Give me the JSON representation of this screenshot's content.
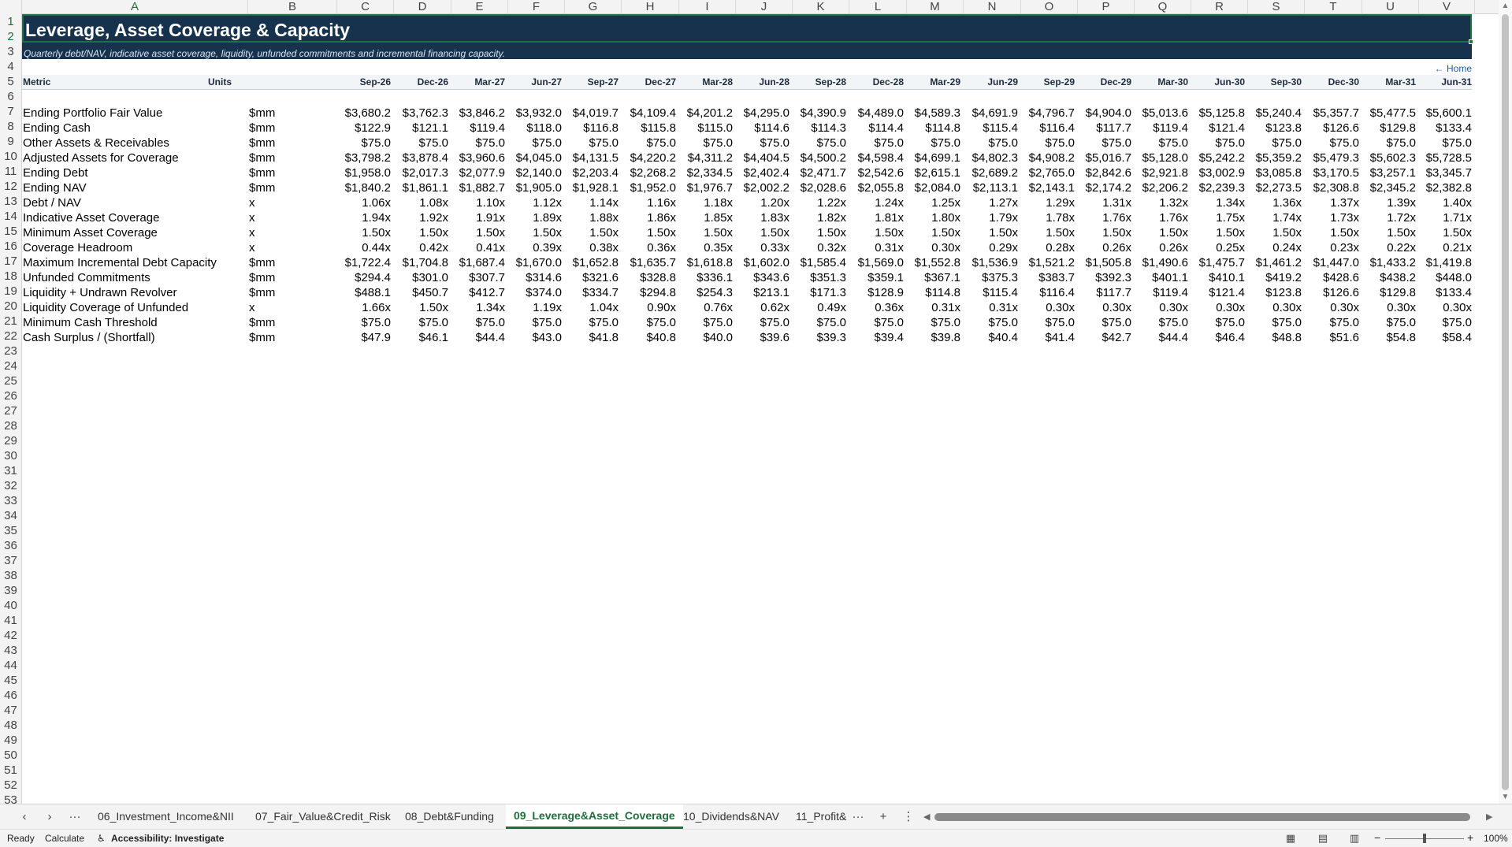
{
  "columns": [
    "A",
    "B",
    "C",
    "D",
    "E",
    "F",
    "G",
    "H",
    "I",
    "J",
    "K",
    "L",
    "M",
    "N",
    "O",
    "P",
    "Q",
    "R",
    "S",
    "T",
    "U",
    "V"
  ],
  "sheet": {
    "title": "Leverage, Asset Coverage & Capacity",
    "subtitle": "Quarterly debt/NAV, indicative asset coverage, liquidity, unfunded commitments and incremental financing capacity.",
    "home_link": "← Home",
    "header": {
      "metric": "Metric",
      "units": "Units"
    },
    "periods": [
      "Sep-26",
      "Dec-26",
      "Mar-27",
      "Jun-27",
      "Sep-27",
      "Dec-27",
      "Mar-28",
      "Jun-28",
      "Sep-28",
      "Dec-28",
      "Mar-29",
      "Jun-29",
      "Sep-29",
      "Dec-29",
      "Mar-30",
      "Jun-30",
      "Sep-30",
      "Dec-30",
      "Mar-31",
      "Jun-31"
    ],
    "rows": [
      {
        "metric": "Ending Portfolio Fair Value",
        "units": "$mm",
        "values": [
          "$3,680.2",
          "$3,762.3",
          "$3,846.2",
          "$3,932.0",
          "$4,019.7",
          "$4,109.4",
          "$4,201.2",
          "$4,295.0",
          "$4,390.9",
          "$4,489.0",
          "$4,589.3",
          "$4,691.9",
          "$4,796.7",
          "$4,904.0",
          "$5,013.6",
          "$5,125.8",
          "$5,240.4",
          "$5,357.7",
          "$5,477.5",
          "$5,600.1"
        ]
      },
      {
        "metric": "Ending Cash",
        "units": "$mm",
        "values": [
          "$122.9",
          "$121.1",
          "$119.4",
          "$118.0",
          "$116.8",
          "$115.8",
          "$115.0",
          "$114.6",
          "$114.3",
          "$114.4",
          "$114.8",
          "$115.4",
          "$116.4",
          "$117.7",
          "$119.4",
          "$121.4",
          "$123.8",
          "$126.6",
          "$129.8",
          "$133.4"
        ]
      },
      {
        "metric": "Other Assets & Receivables",
        "units": "$mm",
        "values": [
          "$75.0",
          "$75.0",
          "$75.0",
          "$75.0",
          "$75.0",
          "$75.0",
          "$75.0",
          "$75.0",
          "$75.0",
          "$75.0",
          "$75.0",
          "$75.0",
          "$75.0",
          "$75.0",
          "$75.0",
          "$75.0",
          "$75.0",
          "$75.0",
          "$75.0",
          "$75.0"
        ]
      },
      {
        "metric": "Adjusted Assets for Coverage",
        "units": "$mm",
        "values": [
          "$3,798.2",
          "$3,878.4",
          "$3,960.6",
          "$4,045.0",
          "$4,131.5",
          "$4,220.2",
          "$4,311.2",
          "$4,404.5",
          "$4,500.2",
          "$4,598.4",
          "$4,699.1",
          "$4,802.3",
          "$4,908.2",
          "$5,016.7",
          "$5,128.0",
          "$5,242.2",
          "$5,359.2",
          "$5,479.3",
          "$5,602.3",
          "$5,728.5"
        ]
      },
      {
        "metric": "Ending Debt",
        "units": "$mm",
        "values": [
          "$1,958.0",
          "$2,017.3",
          "$2,077.9",
          "$2,140.0",
          "$2,203.4",
          "$2,268.2",
          "$2,334.5",
          "$2,402.4",
          "$2,471.7",
          "$2,542.6",
          "$2,615.1",
          "$2,689.2",
          "$2,765.0",
          "$2,842.6",
          "$2,921.8",
          "$3,002.9",
          "$3,085.8",
          "$3,170.5",
          "$3,257.1",
          "$3,345.7"
        ]
      },
      {
        "metric": "Ending NAV",
        "units": "$mm",
        "values": [
          "$1,840.2",
          "$1,861.1",
          "$1,882.7",
          "$1,905.0",
          "$1,928.1",
          "$1,952.0",
          "$1,976.7",
          "$2,002.2",
          "$2,028.6",
          "$2,055.8",
          "$2,084.0",
          "$2,113.1",
          "$2,143.1",
          "$2,174.2",
          "$2,206.2",
          "$2,239.3",
          "$2,273.5",
          "$2,308.8",
          "$2,345.2",
          "$2,382.8"
        ]
      },
      {
        "metric": "Debt / NAV",
        "units": "x",
        "values": [
          "1.06x",
          "1.08x",
          "1.10x",
          "1.12x",
          "1.14x",
          "1.16x",
          "1.18x",
          "1.20x",
          "1.22x",
          "1.24x",
          "1.25x",
          "1.27x",
          "1.29x",
          "1.31x",
          "1.32x",
          "1.34x",
          "1.36x",
          "1.37x",
          "1.39x",
          "1.40x"
        ]
      },
      {
        "metric": "Indicative Asset Coverage",
        "units": "x",
        "values": [
          "1.94x",
          "1.92x",
          "1.91x",
          "1.89x",
          "1.88x",
          "1.86x",
          "1.85x",
          "1.83x",
          "1.82x",
          "1.81x",
          "1.80x",
          "1.79x",
          "1.78x",
          "1.76x",
          "1.76x",
          "1.75x",
          "1.74x",
          "1.73x",
          "1.72x",
          "1.71x"
        ]
      },
      {
        "metric": "Minimum Asset Coverage",
        "units": "x",
        "values": [
          "1.50x",
          "1.50x",
          "1.50x",
          "1.50x",
          "1.50x",
          "1.50x",
          "1.50x",
          "1.50x",
          "1.50x",
          "1.50x",
          "1.50x",
          "1.50x",
          "1.50x",
          "1.50x",
          "1.50x",
          "1.50x",
          "1.50x",
          "1.50x",
          "1.50x",
          "1.50x"
        ]
      },
      {
        "metric": "Coverage Headroom",
        "units": "x",
        "values": [
          "0.44x",
          "0.42x",
          "0.41x",
          "0.39x",
          "0.38x",
          "0.36x",
          "0.35x",
          "0.33x",
          "0.32x",
          "0.31x",
          "0.30x",
          "0.29x",
          "0.28x",
          "0.26x",
          "0.26x",
          "0.25x",
          "0.24x",
          "0.23x",
          "0.22x",
          "0.21x"
        ]
      },
      {
        "metric": "Maximum Incremental Debt Capacity",
        "units": "$mm",
        "values": [
          "$1,722.4",
          "$1,704.8",
          "$1,687.4",
          "$1,670.0",
          "$1,652.8",
          "$1,635.7",
          "$1,618.8",
          "$1,602.0",
          "$1,585.4",
          "$1,569.0",
          "$1,552.8",
          "$1,536.9",
          "$1,521.2",
          "$1,505.8",
          "$1,490.6",
          "$1,475.7",
          "$1,461.2",
          "$1,447.0",
          "$1,433.2",
          "$1,419.8"
        ]
      },
      {
        "metric": "Unfunded Commitments",
        "units": "$mm",
        "values": [
          "$294.4",
          "$301.0",
          "$307.7",
          "$314.6",
          "$321.6",
          "$328.8",
          "$336.1",
          "$343.6",
          "$351.3",
          "$359.1",
          "$367.1",
          "$375.3",
          "$383.7",
          "$392.3",
          "$401.1",
          "$410.1",
          "$419.2",
          "$428.6",
          "$438.2",
          "$448.0"
        ]
      },
      {
        "metric": "Liquidity + Undrawn Revolver",
        "units": "$mm",
        "values": [
          "$488.1",
          "$450.7",
          "$412.7",
          "$374.0",
          "$334.7",
          "$294.8",
          "$254.3",
          "$213.1",
          "$171.3",
          "$128.9",
          "$114.8",
          "$115.4",
          "$116.4",
          "$117.7",
          "$119.4",
          "$121.4",
          "$123.8",
          "$126.6",
          "$129.8",
          "$133.4"
        ]
      },
      {
        "metric": "Liquidity Coverage of Unfunded",
        "units": "x",
        "values": [
          "1.66x",
          "1.50x",
          "1.34x",
          "1.19x",
          "1.04x",
          "0.90x",
          "0.76x",
          "0.62x",
          "0.49x",
          "0.36x",
          "0.31x",
          "0.31x",
          "0.30x",
          "0.30x",
          "0.30x",
          "0.30x",
          "0.30x",
          "0.30x",
          "0.30x",
          "0.30x"
        ]
      },
      {
        "metric": "Minimum Cash Threshold",
        "units": "$mm",
        "values": [
          "$75.0",
          "$75.0",
          "$75.0",
          "$75.0",
          "$75.0",
          "$75.0",
          "$75.0",
          "$75.0",
          "$75.0",
          "$75.0",
          "$75.0",
          "$75.0",
          "$75.0",
          "$75.0",
          "$75.0",
          "$75.0",
          "$75.0",
          "$75.0",
          "$75.0",
          "$75.0"
        ]
      },
      {
        "metric": "Cash Surplus / (Shortfall)",
        "units": "$mm",
        "values": [
          "$47.9",
          "$46.1",
          "$44.4",
          "$43.0",
          "$41.8",
          "$40.8",
          "$40.0",
          "$39.6",
          "$39.3",
          "$39.4",
          "$39.8",
          "$40.4",
          "$41.4",
          "$42.7",
          "$44.4",
          "$46.4",
          "$48.8",
          "$51.6",
          "$54.8",
          "$58.4"
        ]
      }
    ]
  },
  "tabs": {
    "nav_prev": "‹",
    "nav_next": "›",
    "more_left": "···",
    "items": [
      "06_Investment_Income&NII",
      "07_Fair_Value&Credit_Risk",
      "08_Debt&Funding",
      "09_Leverage&Asset_Coverage",
      "10_Dividends&NAV",
      "11_Profit&"
    ],
    "active_index": 3,
    "more_right": "···",
    "add": "+",
    "options": "⋮"
  },
  "status": {
    "ready": "Ready",
    "calculate": "Calculate",
    "accessibility": "Accessibility: Investigate",
    "zoom_minus": "−",
    "zoom_plus": "+",
    "zoom": "100%"
  },
  "colors": {
    "banner": "#17324d",
    "accent": "#1e6e3c",
    "link": "#1f5fa8"
  },
  "icons": {
    "accessibility": "accessibility-icon",
    "normal_view": "normal-view-icon",
    "page_layout": "page-layout-icon",
    "page_break": "page-break-preview-icon"
  }
}
